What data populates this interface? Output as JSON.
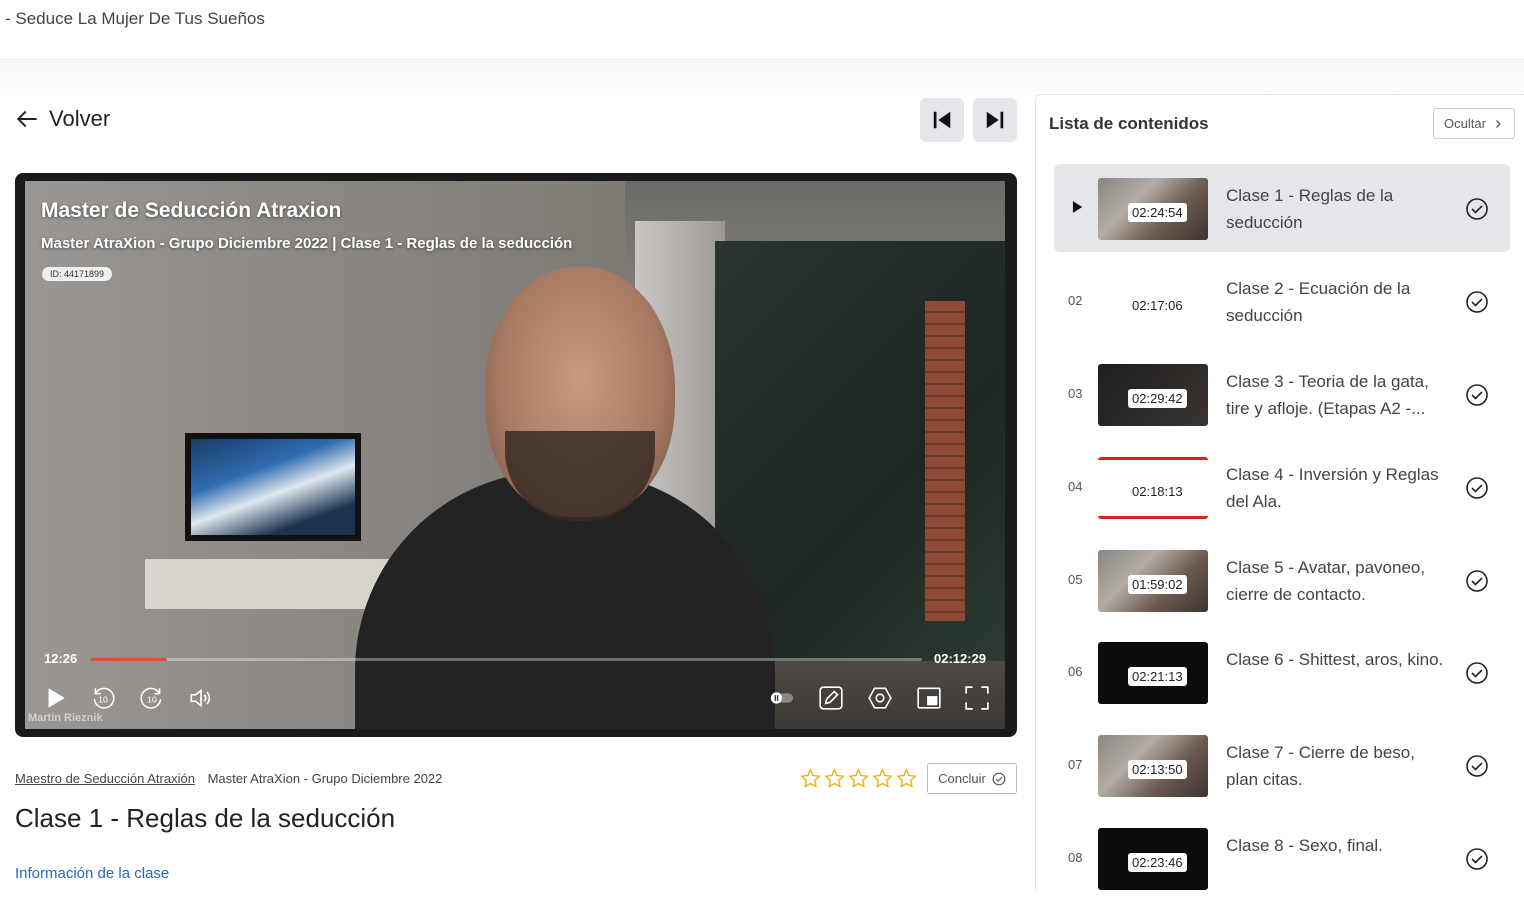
{
  "site": {
    "title": "- Seduce La Mujer De Tus Sueños"
  },
  "nav": {
    "back_label": "Volver"
  },
  "player": {
    "overlay_title": "Master de Seducción Atraxion",
    "overlay_subtitle": "Master AtraXion - Grupo Diciembre 2022 | Clase 1 - Reglas de la seducción",
    "id_badge": "ID: 44171899",
    "watermark": "Martin Rieznik",
    "current_time": "12:26",
    "total_time": "02:12:29",
    "progress_fraction": 0.092
  },
  "lesson": {
    "breadcrumb_course": "Maestro de Seducción Atraxión",
    "breadcrumb_group": "Master AtraXion - Grupo Diciembre 2022",
    "title": "Clase 1 - Reglas de la seducción",
    "info_link": "Información de la clase",
    "rating_stars": 5,
    "conclude_label": "Concluir"
  },
  "sidebar": {
    "title": "Lista de contenidos",
    "hide_label": "Ocultar",
    "items": [
      {
        "num": "",
        "duration": "02:24:54",
        "label": "Clase 1 - Reglas de la seducción",
        "thumb": "video",
        "active": true
      },
      {
        "num": "02",
        "duration": "02:17:06",
        "label": "Clase 2 - Ecuación de la seducción",
        "thumb": "slide",
        "active": false
      },
      {
        "num": "03",
        "duration": "02:29:42",
        "label": "Clase 3 - Teoria de la gata, tire y afloje. (Etapas A2 -...",
        "thumb": "dark",
        "active": false
      },
      {
        "num": "04",
        "duration": "02:18:13",
        "label": "Clase 4 - Inversión y Reglas del Ala.",
        "thumb": "red",
        "active": false
      },
      {
        "num": "05",
        "duration": "01:59:02",
        "label": "Clase 5 - Avatar, pavoneo, cierre de contacto.",
        "thumb": "video",
        "active": false
      },
      {
        "num": "06",
        "duration": "02:21:13",
        "label": "Clase 6 - Shittest, aros, kino.",
        "thumb": "black",
        "active": false
      },
      {
        "num": "07",
        "duration": "02:13:50",
        "label": "Clase 7 - Cierre de beso, plan citas.",
        "thumb": "video",
        "active": false
      },
      {
        "num": "08",
        "duration": "02:23:46",
        "label": "Clase 8 - Sexo, final.",
        "thumb": "black",
        "active": false
      }
    ]
  },
  "colors": {
    "accent": "#e0512f",
    "link": "#2a66c5",
    "star": "#e8b517",
    "active_row": "#e4e6ea"
  }
}
